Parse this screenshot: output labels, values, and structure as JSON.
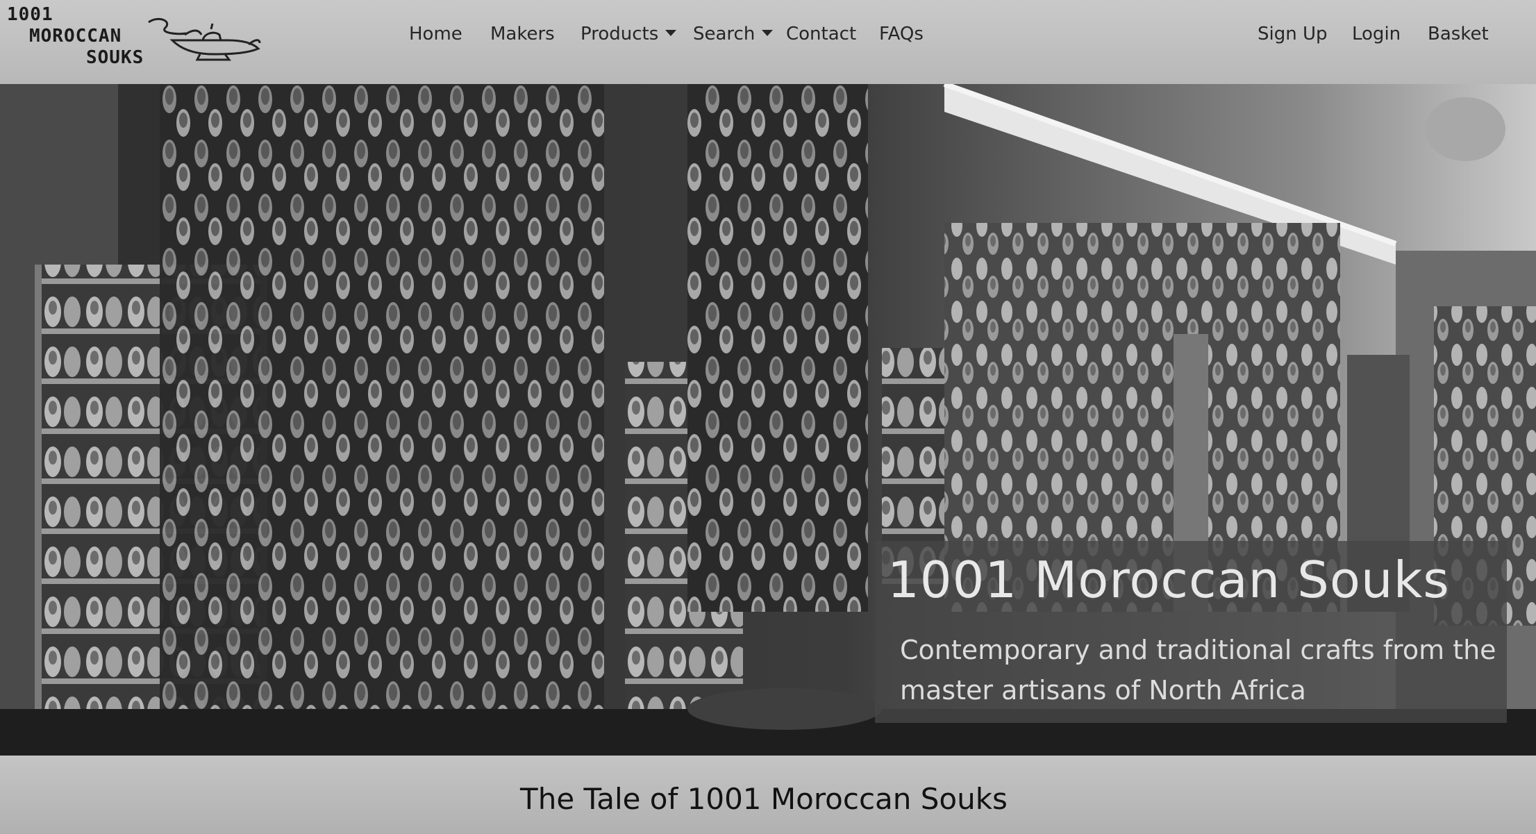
{
  "brand": {
    "logo_line1": "1001",
    "logo_line2": "MOROCCAN",
    "logo_line3": "SOUKS",
    "logo_icon": "oil-lamp-icon"
  },
  "nav": {
    "home": "Home",
    "makers": "Makers",
    "products": "Products",
    "search": "Search",
    "contact": "Contact",
    "faqs": "FAQs",
    "signup": "Sign Up",
    "login": "Login",
    "basket": "Basket"
  },
  "hero": {
    "image": "souk-slipper-market-photo",
    "title": "1001 Moroccan Souks",
    "subtitle": "Contemporary and traditional crafts from the master artisans of North Africa"
  },
  "section": {
    "heading": "The Tale of 1001 Moroccan Souks"
  },
  "colors": {
    "navbar_bg": "#c2c2c2",
    "caption_bg": "#464646",
    "caption_text": "#e8e8e8",
    "section_bg": "#bdbdbd"
  }
}
